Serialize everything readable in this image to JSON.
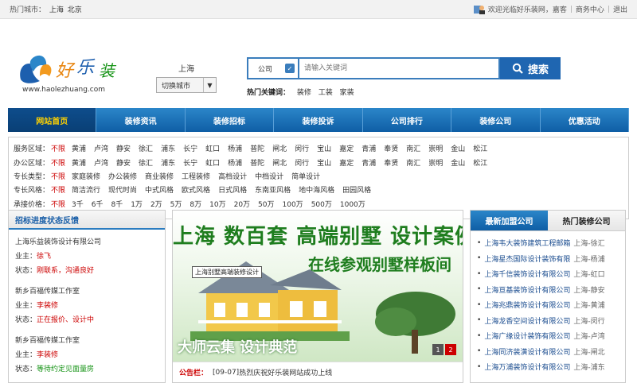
{
  "topbar": {
    "hot_label": "热门城市：",
    "hot_cities": [
      "上海",
      "北京"
    ],
    "welcome": "欢迎光临好乐装网，嘉客",
    "biz_center": "商务中心",
    "logout": "退出"
  },
  "logo": {
    "url": "www.haolezhuang.com"
  },
  "city": {
    "current": "上海",
    "switch_label": "切换城市"
  },
  "search": {
    "category": "公司",
    "placeholder": "请输入关键词",
    "button": "搜索",
    "hot_label": "热门关键词：",
    "keywords": [
      "装修",
      "工装",
      "家装"
    ]
  },
  "nav": {
    "items": [
      "网站首页",
      "装修资讯",
      "装修招标",
      "装修投诉",
      "公司排行",
      "装修公司",
      "优惠活动"
    ],
    "active": 0
  },
  "filters": [
    {
      "label": "服务区域：",
      "all": "不限",
      "options": [
        "黄浦",
        "卢湾",
        "静安",
        "徐汇",
        "浦东",
        "长宁",
        "虹口",
        "杨浦",
        "普陀",
        "闸北",
        "闵行",
        "宝山",
        "嘉定",
        "青浦",
        "奉贤",
        "南汇",
        "崇明",
        "金山",
        "松江"
      ]
    },
    {
      "label": "办公区域：",
      "all": "不限",
      "options": [
        "黄浦",
        "卢湾",
        "静安",
        "徐汇",
        "浦东",
        "长宁",
        "虹口",
        "杨浦",
        "普陀",
        "闸北",
        "闵行",
        "宝山",
        "嘉定",
        "青浦",
        "奉贤",
        "南汇",
        "崇明",
        "金山",
        "松江"
      ]
    },
    {
      "label": "专长类型：",
      "all": "不限",
      "options": [
        "家庭装修",
        "办公装修",
        "商业装修",
        "工程装修",
        "高档设计",
        "中档设计",
        "简单设计"
      ]
    },
    {
      "label": "专长风格：",
      "all": "不限",
      "options": [
        "简洁流行",
        "现代时尚",
        "中式风格",
        "欧式风格",
        "日式风格",
        "东南亚风格",
        "地中海风格",
        "田园风格"
      ]
    },
    {
      "label": "承接价格：",
      "all": "不限",
      "options": [
        "3千",
        "6千",
        "8千",
        "1万",
        "2万",
        "5万",
        "8万",
        "10万",
        "20万",
        "50万",
        "100万",
        "500万",
        "1000万"
      ]
    }
  ],
  "tender": {
    "title": "招标进度状态反馈",
    "owner_label": "业主：",
    "status_label": "状态：",
    "entries": [
      {
        "company": "上海乐益装饰设计有限公司",
        "owner": "徐飞",
        "status": "刚联系，沟通良好",
        "status_color": "red"
      },
      {
        "company": "新乡百福传媒工作室",
        "owner": "李装修",
        "status": "正在报价、设计中",
        "status_color": "red"
      },
      {
        "company": "新乡百福传媒工作室",
        "owner": "李装修",
        "status": "等待约定见面量房",
        "status_color": "green"
      }
    ]
  },
  "banner": {
    "line1": "上海 数百套 高端别墅 设计案例",
    "line2": "在线参观别墅样板间",
    "line3": "大师云集 设计典范",
    "tag": "上海别墅高端装修设计",
    "pages": [
      "1",
      "2"
    ]
  },
  "notice": {
    "label": "公告栏：",
    "date": "[09-07]",
    "text": "热烈庆祝好乐装网站成功上线"
  },
  "sidebar": {
    "tabs": [
      "最新加盟公司",
      "热门装修公司"
    ],
    "items": [
      {
        "company": "上海韦大装饰建筑工程邮箱",
        "area": "上海-徐汇"
      },
      {
        "company": "上海星杰国际设计装饰有限",
        "area": "上海-杨浦"
      },
      {
        "company": "上海千信装饰设计有限公司",
        "area": "上海-虹口"
      },
      {
        "company": "上海亘基装饰设计有限公司",
        "area": "上海-静安"
      },
      {
        "company": "上海兆鼎装饰设计有限公司",
        "area": "上海-黄浦"
      },
      {
        "company": "上海龙香空间设计有限公司",
        "area": "上海-闵行"
      },
      {
        "company": "上海广缘设计装饰有限公司",
        "area": "上海-卢湾"
      },
      {
        "company": "上海同济装潢设计有限公司",
        "area": "上海-闸北"
      },
      {
        "company": "上海万浦装饰设计有限公司",
        "area": "上海-浦东"
      }
    ]
  },
  "colors": {
    "nav_blue": "#1f66b1",
    "active_yellow": "#ffd200",
    "red": "#cc0000",
    "green": "#159315"
  }
}
